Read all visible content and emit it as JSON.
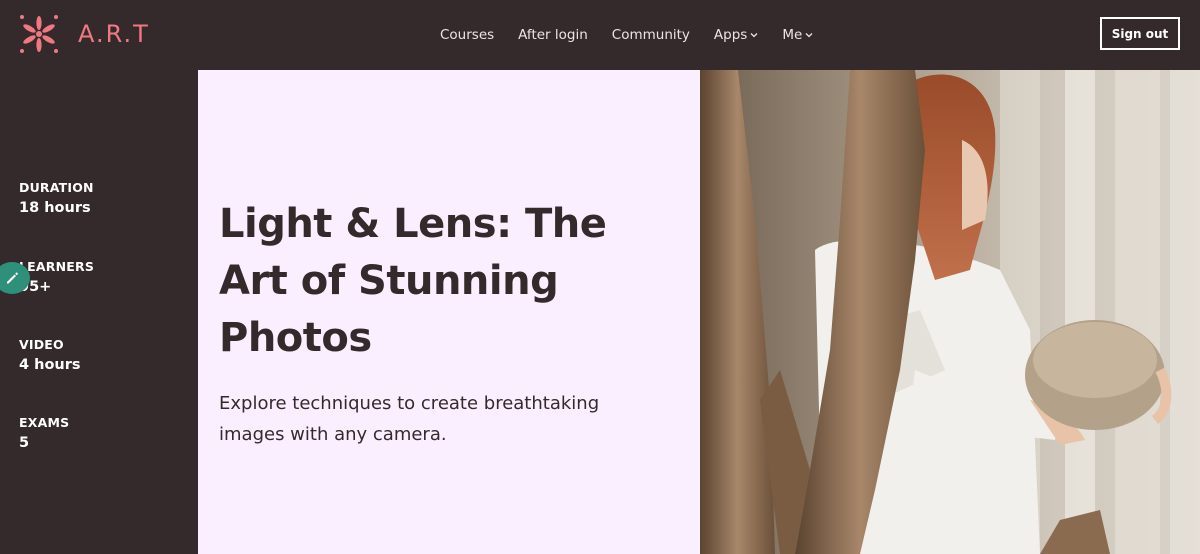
{
  "brand": {
    "name": "A.R.T",
    "logo_icon": "asterisk-flower-icon",
    "accent": "#f07882"
  },
  "nav": {
    "items": [
      {
        "label": "Courses"
      },
      {
        "label": "After login"
      },
      {
        "label": "Community"
      },
      {
        "label": "Apps",
        "dropdown": true
      },
      {
        "label": "Me",
        "dropdown": true
      }
    ]
  },
  "header": {
    "signout_label": "Sign out"
  },
  "stats": [
    {
      "label": "DURATION",
      "value": "18 hours"
    },
    {
      "label": "LEARNERS",
      "value": "95+"
    },
    {
      "label": "VIDEO",
      "value": "4 hours"
    },
    {
      "label": "EXAMS",
      "value": "5"
    }
  ],
  "hero": {
    "title": "Light & Lens: The Art of Stunning Photos",
    "subtitle": "Explore techniques to create breathtaking images with any camera."
  },
  "colors": {
    "dark": "#352a2b",
    "hero_bg": "#f9efff",
    "edit_bubble": "#2e8f7b"
  }
}
